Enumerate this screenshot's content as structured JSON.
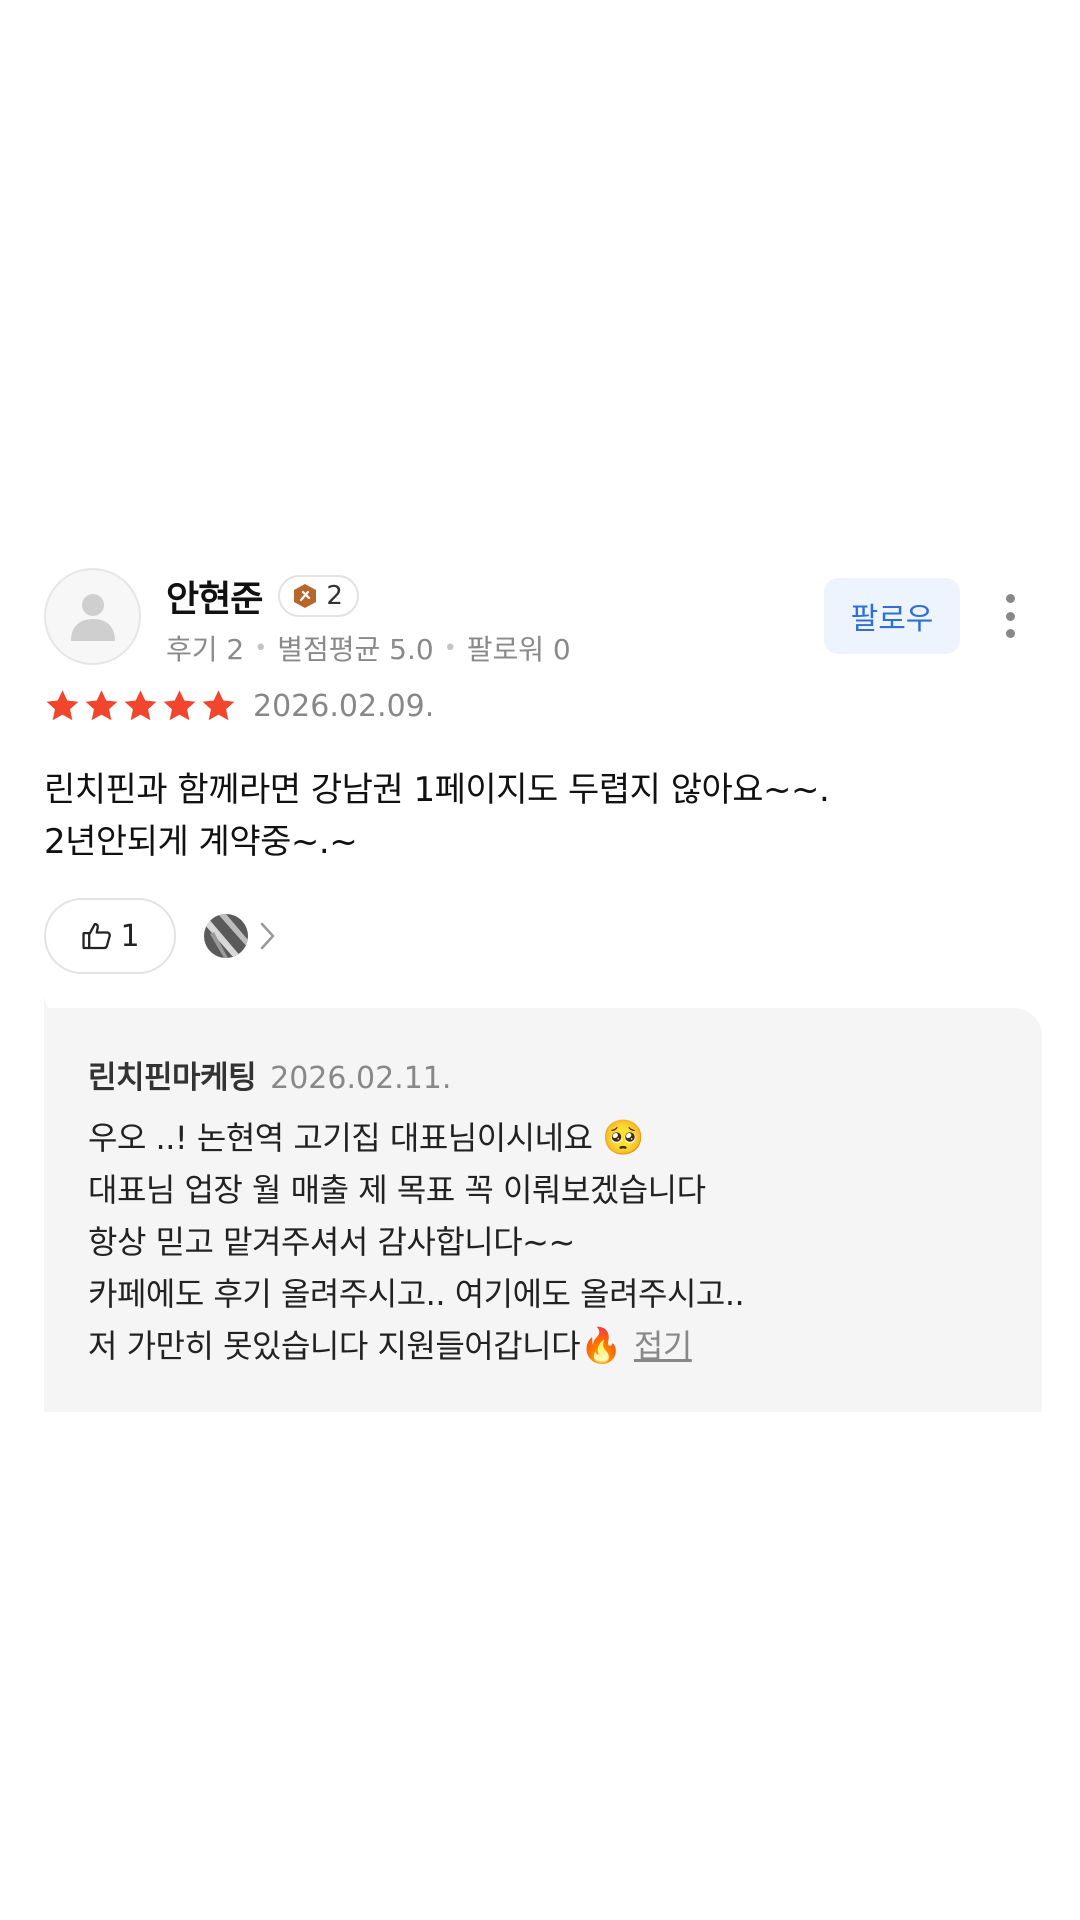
{
  "review": {
    "user": {
      "name": "안현준",
      "level": "2",
      "meta": [
        "후기 2",
        "별점평균 5.0",
        "팔로워 0"
      ]
    },
    "follow_label": "팔로우",
    "rating": 5,
    "date": "2026.02.09.",
    "text_lines": [
      "린치핀과 함께라면 강남권 1페이지도 두렵지 않아요~~.",
      "2년안되게 계약중~.~"
    ],
    "like_count": "1"
  },
  "reply": {
    "author": "린치핀마케팅",
    "date": "2026.02.11.",
    "lines": [
      "우오 ..! 논현역 고기집 대표님이시네요 ",
      "대표님 업장 월 매출 제 목표 꼭 이뤄보겠습니다",
      "항상 믿고 맡겨주셔서 감사합니다~~",
      "카페에도 후기 올려주시고.. 여기에도 올려주시고..",
      "저 가만히 못있습니다 지원들어갑니다"
    ],
    "emoji_1": "🥺",
    "emoji_2": "🔥",
    "collapse_label": "접기"
  },
  "colors": {
    "star": "#f2452e",
    "follow_text": "#2f6fd6",
    "follow_bg": "#eef4fd",
    "reply_bg": "#f5f5f5"
  }
}
